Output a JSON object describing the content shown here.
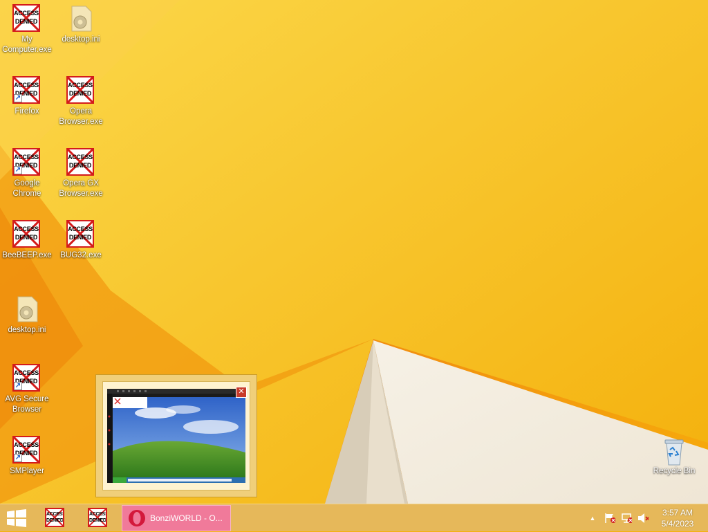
{
  "desktop_icons": [
    {
      "label": "My Computer.exe",
      "type": "access-denied",
      "shortcut": false
    },
    {
      "label": "desktop.ini",
      "type": "ini-file",
      "shortcut": false
    },
    {
      "label": "Firefox",
      "type": "access-denied",
      "shortcut": true
    },
    {
      "label": "Opera Browser.exe",
      "type": "access-denied",
      "shortcut": false
    },
    {
      "label": "Google Chrome",
      "type": "access-denied",
      "shortcut": true
    },
    {
      "label": "Opera GX Browser.exe",
      "type": "access-denied",
      "shortcut": false
    },
    {
      "label": "BeeBEEP.exe",
      "type": "access-denied",
      "shortcut": false
    },
    {
      "label": "BUG32.exe",
      "type": "access-denied",
      "shortcut": false
    },
    {
      "label": "desktop.ini",
      "type": "ini-file",
      "shortcut": false
    },
    {
      "label": "AVG Secure Browser",
      "type": "access-denied",
      "shortcut": true
    },
    {
      "label": "SMPlayer",
      "type": "access-denied",
      "shortcut": true
    },
    {
      "label": "Recycle Bin",
      "type": "recycle-bin-icon",
      "shortcut": false
    }
  ],
  "access_denied_text": {
    "line1": "ACCESS",
    "line2": "DENIED"
  },
  "taskbar": {
    "active_window_label": "BonziWORLD - O...",
    "tray_overflow": "▲"
  },
  "clock": {
    "time": "3:57 AM",
    "date": "5/4/2023"
  },
  "colors": {
    "wallpaper": "#f5b00c",
    "taskbar": "#e6b85a",
    "active_task": "#f07a9a",
    "denied_red": "#d41b1b"
  }
}
